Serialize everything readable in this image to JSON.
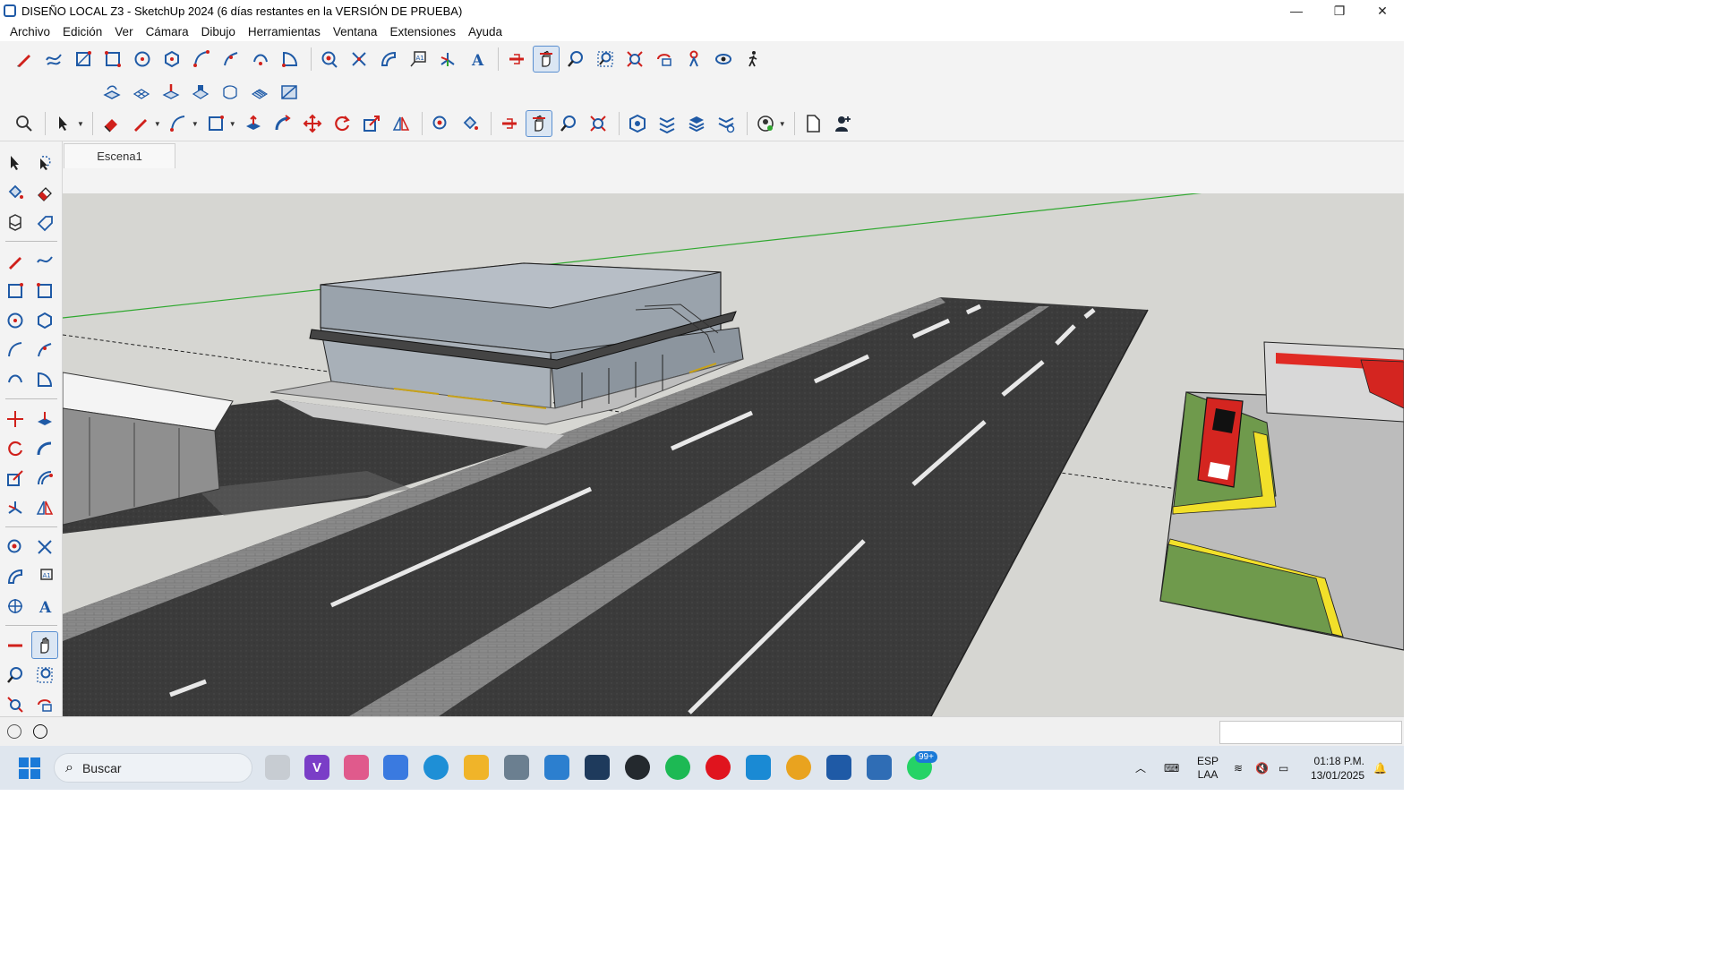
{
  "window": {
    "title": "DISEÑO LOCAL Z3 - SketchUp 2024 (6 días restantes en la VERSIÓN DE PRUEBA)",
    "controls": [
      "—",
      "❐",
      "✕"
    ]
  },
  "menu": [
    "Archivo",
    "Edición",
    "Ver",
    "Cámara",
    "Dibujo",
    "Herramientas",
    "Ventana",
    "Extensiones",
    "Ayuda"
  ],
  "scenes": {
    "active": "Escena1"
  },
  "taskbar": {
    "search_placeholder": "Buscar",
    "whatsapp_badge": "99+",
    "lang_top": "ESP",
    "lang_bottom": "LAA",
    "time": "01:18 P.M.",
    "date": "13/01/2025"
  },
  "colors": {
    "axis_green": "#2fa82f",
    "tool_red": "#d0201b",
    "tool_blue": "#1f5aa6",
    "active_tool_bg": "#dbe6f3"
  }
}
